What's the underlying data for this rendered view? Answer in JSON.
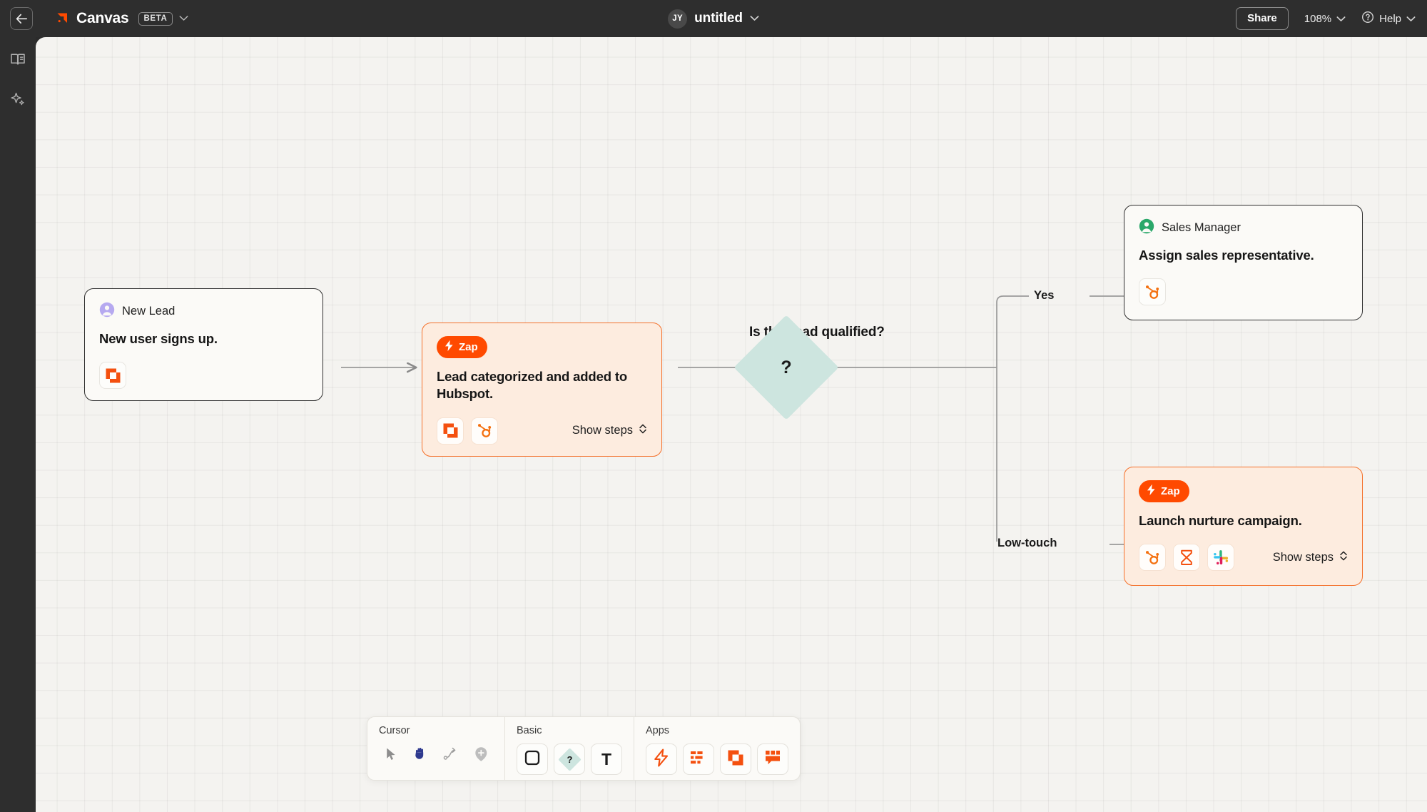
{
  "topbar": {
    "back_icon": "arrow-left-icon",
    "brand_icon": "canvas-logo-icon",
    "brand_name": "Canvas",
    "beta_label": "BETA",
    "brand_caret_icon": "chevron-down-icon",
    "avatar_initials": "JY",
    "doc_title": "untitled",
    "doc_caret_icon": "chevron-down-icon",
    "share_label": "Share",
    "zoom_level": "108%",
    "zoom_caret_icon": "chevron-down-icon",
    "help_icon": "question-circle-icon",
    "help_label": "Help",
    "help_caret_icon": "chevron-down-icon"
  },
  "rail": {
    "items": [
      {
        "icon": "book-open-icon",
        "name": "library"
      },
      {
        "icon": "sparkle-icon",
        "name": "ai-assist"
      }
    ]
  },
  "canvas": {
    "nodes": [
      {
        "id": "new-lead",
        "kind": "plain",
        "owner": "New Lead",
        "owner_avatar_color": "#b6a9f0",
        "title": "New user signs up.",
        "apps": [
          {
            "name": "interfaces-icon"
          }
        ]
      },
      {
        "id": "lead-categorized",
        "kind": "zap",
        "badge": "Zap",
        "title": "Lead categorized and added to Hubspot.",
        "apps": [
          {
            "name": "interfaces-icon"
          },
          {
            "name": "hubspot-icon"
          }
        ],
        "show_steps": "Show steps",
        "show_steps_icon": "chevron-updown-icon"
      },
      {
        "id": "sales-manager",
        "kind": "plain",
        "owner": "Sales Manager",
        "owner_avatar_color": "#2aa86a",
        "title": "Assign sales representative.",
        "apps": [
          {
            "name": "hubspot-icon"
          }
        ]
      },
      {
        "id": "nurture-campaign",
        "kind": "zap",
        "badge": "Zap",
        "title": "Launch nurture campaign.",
        "apps": [
          {
            "name": "hubspot-icon"
          },
          {
            "name": "delay-icon"
          },
          {
            "name": "slack-icon"
          }
        ],
        "show_steps": "Show steps",
        "show_steps_icon": "chevron-updown-icon"
      }
    ],
    "decision": {
      "label": "Is this lead qualified?",
      "glyph": "?",
      "fill": "#cde5df"
    },
    "edge_labels": [
      {
        "id": "yes",
        "text": "Yes"
      },
      {
        "id": "low-touch",
        "text": "Low-touch"
      }
    ]
  },
  "toolbar": {
    "groups": [
      {
        "label": "Cursor",
        "style": "plain",
        "tools": [
          {
            "name": "pointer-icon",
            "active": false
          },
          {
            "name": "hand-icon",
            "active": true
          },
          {
            "name": "connector-icon",
            "active": false
          },
          {
            "name": "comment-add-icon",
            "active": false
          }
        ]
      },
      {
        "label": "Basic",
        "style": "boxed",
        "tools": [
          {
            "name": "rectangle-shape-icon"
          },
          {
            "name": "decision-diamond-icon",
            "glyph": "?"
          },
          {
            "name": "text-tool-icon",
            "glyph": "T"
          }
        ]
      },
      {
        "label": "Apps",
        "style": "boxed",
        "tools": [
          {
            "name": "zap-bolt-icon"
          },
          {
            "name": "tables-icon"
          },
          {
            "name": "interfaces-icon"
          },
          {
            "name": "chatbots-icon"
          }
        ]
      }
    ]
  },
  "colors": {
    "accent_orange": "#ff4a00",
    "zap_card_bg": "#fdecdf",
    "canvas_bg": "#f4f3f0",
    "chrome_dark": "#2e2e2e",
    "diamond_teal": "#cde5df"
  }
}
